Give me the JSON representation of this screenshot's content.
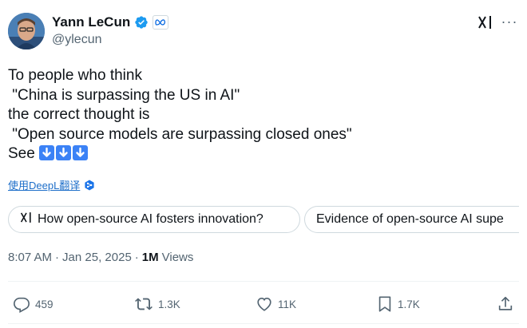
{
  "author": {
    "display_name": "Yann LeCun",
    "handle": "@ylecun",
    "avatar_icon": "avatar-photo",
    "verified_icon": "verified-badge-icon",
    "affiliation_icon": "meta-logo-icon"
  },
  "tweet": {
    "lines": [
      "To people who think",
      " \"China is surpassing the US in AI\"",
      "the correct thought is",
      " \"Open source models are surpassing closed ones\"",
      "See "
    ],
    "emojis": [
      "down-arrow",
      "down-arrow",
      "down-arrow"
    ]
  },
  "translate_link": "使用DeepL翻译",
  "grok_chips": [
    {
      "label": "How open-source AI fosters innovation?"
    },
    {
      "label": "Evidence of open-source AI supe"
    }
  ],
  "meta": {
    "time": "8:07 AM",
    "separator1": "·",
    "date": "Jan 25, 2025",
    "separator2": "·",
    "views_count": "1M",
    "views_label": "Views"
  },
  "actions": {
    "replies": "459",
    "reposts": "1.3K",
    "likes": "11K",
    "bookmarks": "1.7K"
  },
  "colors": {
    "text": "#0f1419",
    "secondary": "#536471",
    "verified": "#1d9bf0",
    "link": "#1d6ec9",
    "border": "#cfd9de"
  }
}
